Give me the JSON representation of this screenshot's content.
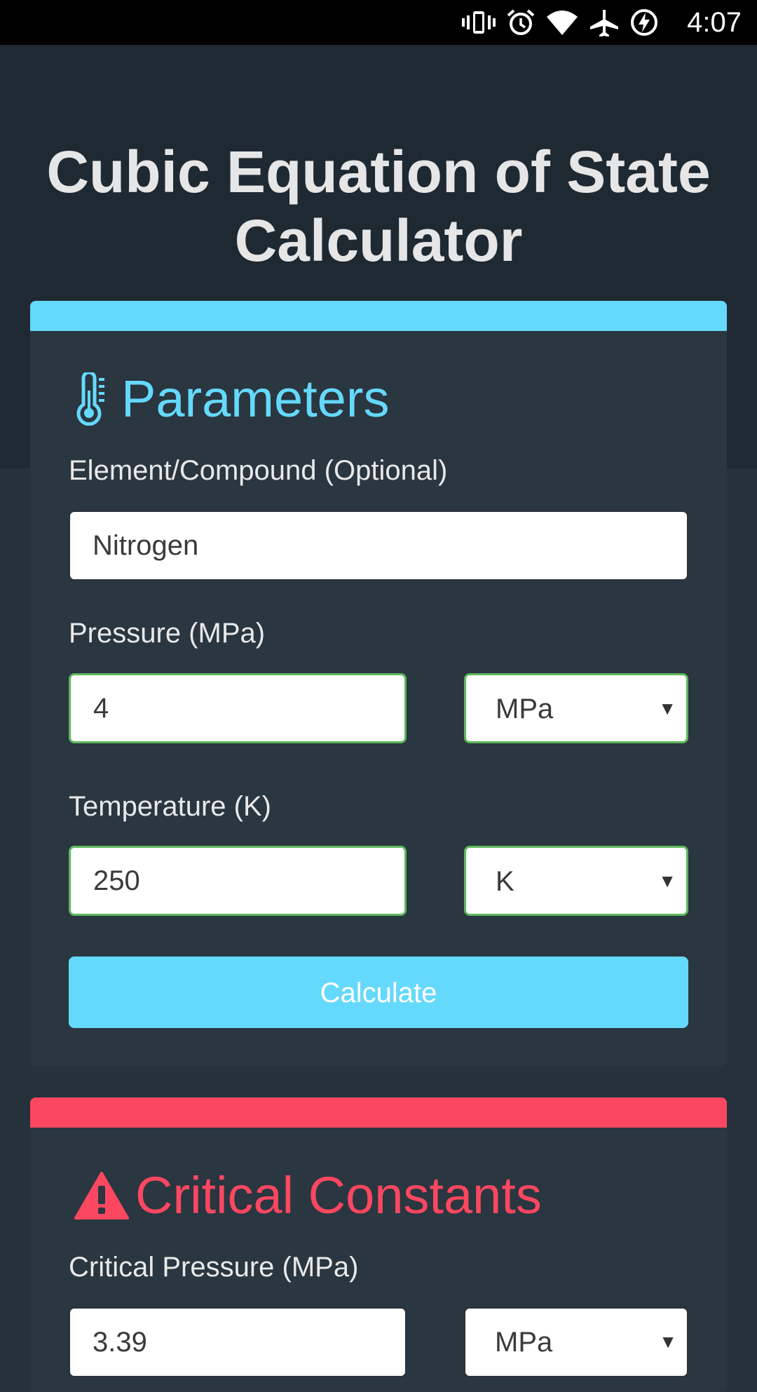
{
  "status_bar": {
    "time": "4:07",
    "icons": [
      "vibrate-icon",
      "alarm-icon",
      "wifi-icon",
      "airplane-mode-icon",
      "battery-charging-icon"
    ]
  },
  "page": {
    "title": "Cubic Equation of State Calculator"
  },
  "parameters": {
    "heading": "Parameters",
    "icon": "thermometer-icon",
    "accent_color": "#65d9fb",
    "compound_label": "Element/Compound (Optional)",
    "compound_value": "Nitrogen",
    "pressure_label": "Pressure (MPa)",
    "pressure_value": "4",
    "pressure_unit": "MPa",
    "temperature_label": "Temperature (K)",
    "temperature_value": "250",
    "temperature_unit": "K",
    "calculate_label": "Calculate"
  },
  "critical_constants": {
    "heading": "Critical Constants",
    "icon": "warning-icon",
    "accent_color": "#fc4761",
    "critical_pressure_label": "Critical Pressure (MPa)",
    "critical_pressure_value": "3.39",
    "critical_pressure_unit": "MPa"
  },
  "colors": {
    "valid_border": "#5cb85c",
    "background": "#25313b",
    "card": "#2a3640"
  }
}
